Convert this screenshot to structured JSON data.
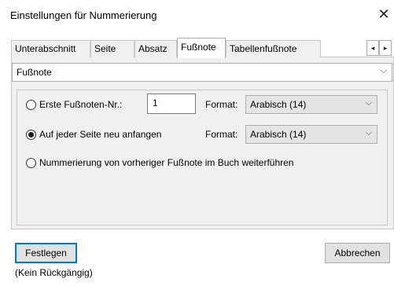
{
  "window": {
    "title": "Einstellungen für Nummerierung"
  },
  "tabs": [
    {
      "label": "Unterabschnitt",
      "active": false
    },
    {
      "label": "Seite",
      "active": false
    },
    {
      "label": "Absatz",
      "active": false
    },
    {
      "label": "Fußnote",
      "active": true
    },
    {
      "label": "Tabellenfußnote",
      "active": false
    }
  ],
  "tab_scroll": {
    "left": "◂",
    "right": "▸"
  },
  "type_select": {
    "value": "Fußnote"
  },
  "options": {
    "start_number": {
      "label": "Erste Fußnoten-Nr.:",
      "value": "1",
      "selected": false
    },
    "restart_each_page": {
      "label": "Auf jeder Seite neu anfangen",
      "selected": true
    },
    "continue_previous": {
      "label": "Nummerierung von vorheriger Fußnote im Buch weiterführen",
      "selected": false
    }
  },
  "format": {
    "label": "Format:",
    "first_value": "Arabisch (14)",
    "second_value": "Arabisch (14)"
  },
  "buttons": {
    "apply": "Festlegen",
    "cancel": "Abbrechen"
  },
  "footer": {
    "undo_note": "(Kein Rückgängig)"
  },
  "icons": {
    "close": "close-icon",
    "dropdown": "chevron-down-icon"
  }
}
